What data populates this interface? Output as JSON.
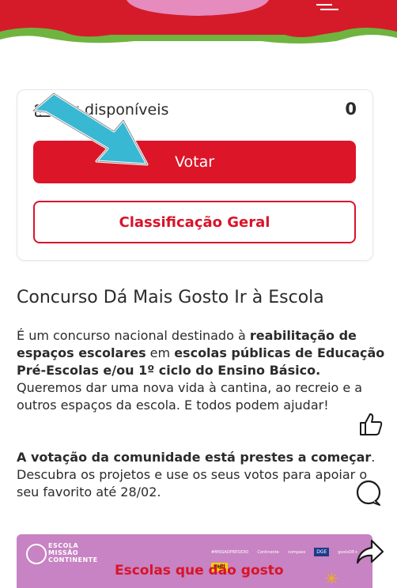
{
  "votes": {
    "label": "Votos disponíveis",
    "visible_label": "tos disponíveis",
    "count": "0"
  },
  "buttons": {
    "vote": "Votar",
    "ranking": "Classificação Geral"
  },
  "article": {
    "title": "Concurso Dá Mais Gosto Ir à Escola",
    "p1_text1": "É um concurso nacional destinado à ",
    "p1_bold1": "reabilitação de espaços escolares",
    "p1_text2": " em ",
    "p1_bold2": "escolas públicas de Educação Pré-Escolas e/ou 1º ciclo do Ensino Básico.",
    "p1_line2": "Queremos dar uma nova vida à cantina, ao recreio e a outros espaços da escola. E todos podem ajudar!",
    "p2_bold": "A votação da comunidade está prestes a começar",
    "p2_text": ". Descubra os projetos e use os seus votos para apoiar o seu favorito até 28/02."
  },
  "banner": {
    "brand_line1": "ESCOLA",
    "brand_line2": "MISSÃO",
    "brand_line3": "CONTINENTE",
    "title": "Escolas que dão gosto",
    "sponsors": [
      "#MISSAOPRESIDIO",
      "Continente",
      "compass",
      "DGE",
      "gostoDE+",
      "UHU"
    ]
  },
  "colors": {
    "brand_red": "#dd1528",
    "hero_green": "#6fb43f",
    "hero_pink": "#e58bbe",
    "banner_purple": "#c783c3",
    "annotation_arrow": "#39b8d4"
  },
  "icons": [
    "ticket-icon",
    "arrow-pointer-icon",
    "like-icon",
    "comment-icon",
    "share-icon",
    "star-icon",
    "logo-icon"
  ]
}
